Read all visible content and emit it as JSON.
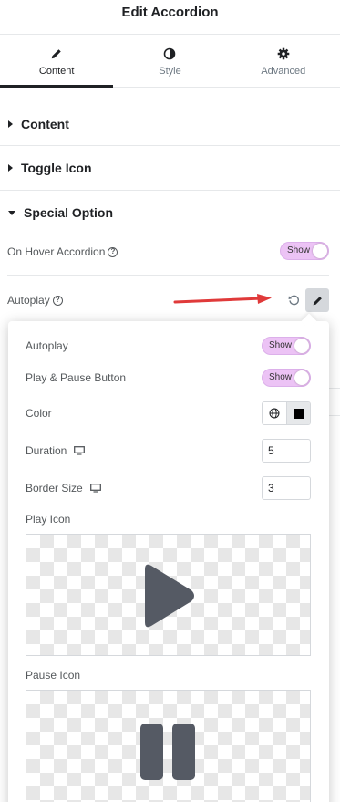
{
  "header": {
    "title": "Edit Accordion"
  },
  "tabs": [
    {
      "label": "Content",
      "icon": "pencil-icon"
    },
    {
      "label": "Style",
      "icon": "half-circle-icon"
    },
    {
      "label": "Advanced",
      "icon": "gear-icon"
    }
  ],
  "sections": {
    "content": "Content",
    "toggle_icon": "Toggle Icon",
    "special_option": "Special Option"
  },
  "special": {
    "hover_label": "On Hover Accordion",
    "hover_toggle": "Show",
    "autoplay_label": "Autoplay"
  },
  "popover": {
    "autoplay_label": "Autoplay",
    "autoplay_toggle": "Show",
    "play_pause_label": "Play & Pause Button",
    "play_pause_toggle": "Show",
    "color_label": "Color",
    "duration_label": "Duration",
    "duration_value": "5",
    "border_label": "Border Size",
    "border_value": "3",
    "play_icon_label": "Play Icon",
    "pause_icon_label": "Pause Icon"
  },
  "colors": {
    "toggle_bg": "#ecc3f5",
    "icon_fill": "#555a64",
    "arrow": "#e03a3a",
    "swatch": "#000000"
  }
}
